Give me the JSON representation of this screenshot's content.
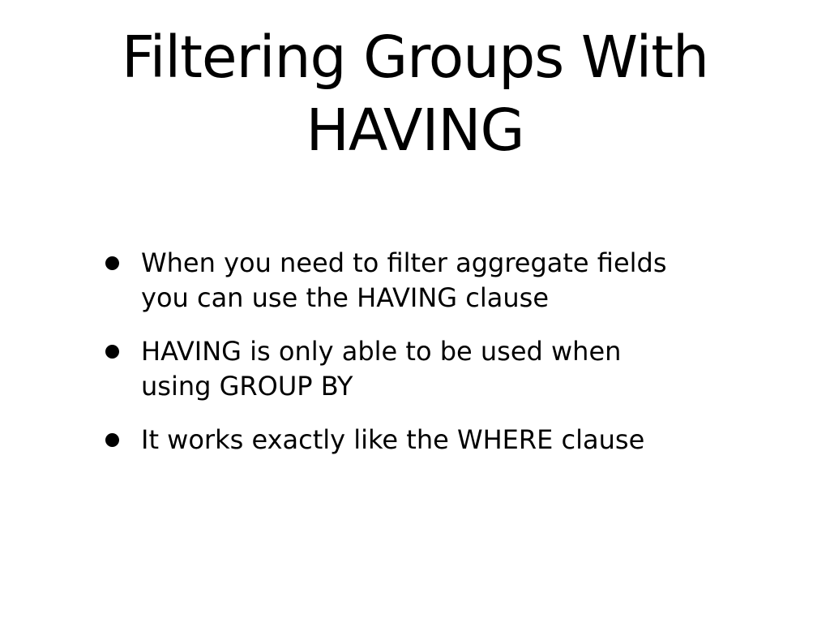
{
  "slide": {
    "title_line1": "Filtering Groups With",
    "title_line2": "HAVING",
    "bullets": [
      {
        "line1": "When you need to filter aggregate fields",
        "line2": "you can use the HAVING clause"
      },
      {
        "line1": "HAVING is only able to be used when",
        "line2": "using GROUP BY"
      },
      {
        "line1": "It works exactly like the WHERE clause"
      }
    ]
  }
}
